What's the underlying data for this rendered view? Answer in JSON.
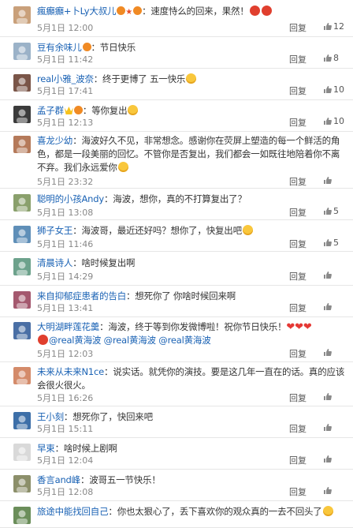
{
  "comments": [
    {
      "user": "瘋癲癲+卜Ly大叔儿",
      "text": "：速度恃么的回来，果然！",
      "time": "5月1日 12:00",
      "reply": "回复",
      "likes": "12",
      "avatar": "#c9a07a"
    },
    {
      "user": "豆有余味儿",
      "text": "：节日快乐",
      "time": "5月1日 11:42",
      "reply": "回复",
      "likes": "8",
      "avatar": "#9bb2c8"
    },
    {
      "user": "real小雅_波奈",
      "text": "：终于更博了 五一快乐",
      "time": "5月1日 17:41",
      "reply": "回复",
      "likes": "10",
      "avatar": "#7a5548"
    },
    {
      "user": "孟子群",
      "text": "：等你复出",
      "time": "5月1日 12:13",
      "reply": "回复",
      "likes": "10",
      "avatar": "#3b3b3b"
    },
    {
      "user": "喜龙少幼",
      "text": "：海波好久不见，非常想念。感谢你在荧屏上塑造的每一个鲜活的角色，都是一段美丽的回忆。不管你是否复出，我们都会一如既往地陪着你不离不弃。我们永远爱你",
      "time": "5月1日 23:32",
      "reply": "回复",
      "likes": "",
      "avatar": "#b57a5a"
    },
    {
      "user": "聪明的小孩Andy",
      "text": "：海波，想你，真的不打算复出了？",
      "time": "5月1日 13:08",
      "reply": "回复",
      "likes": "5",
      "avatar": "#8aa06c"
    },
    {
      "user": "狮子女王",
      "text": "：海波哥，最近还好吗？想你了，快复出吧",
      "time": "5月1日 11:46",
      "reply": "回复",
      "likes": "5",
      "avatar": "#5f8fb8"
    },
    {
      "user": "清晨诗人",
      "text": "：啥时候复出啊",
      "time": "5月1日 14:29",
      "reply": "回复",
      "likes": "",
      "avatar": "#6da28c"
    },
    {
      "user": "来自抑郁症患者的告白",
      "text": "：想死你了 你啥时候回来啊",
      "time": "5月1日 13:41",
      "reply": "回复",
      "likes": "",
      "avatar": "#a4586e"
    },
    {
      "user": "大明湖畔莲花羹",
      "text": "：海波，终于等到你发微博啦！祝你节日快乐！",
      "mentions": "@real黄海波 @real黄海波 @real黄海波",
      "time": "5月1日 12:03",
      "reply": "回复",
      "likes": "",
      "avatar": "#4a6fa5"
    },
    {
      "user": "未来从未来N1ce",
      "text": "：说实话。就凭你的演技。要是这几年一直在的话。真的应该会很火很火。",
      "time": "5月1日 16:26",
      "reply": "回复",
      "likes": "",
      "avatar": "#d48b6a"
    },
    {
      "user": "王小刻",
      "text": "：想死你了，快回来吧",
      "time": "5月1日 15:11",
      "reply": "回复",
      "likes": "",
      "avatar": "#3d6fa8"
    },
    {
      "user": "早束",
      "text": "：啥时候上剧啊",
      "time": "5月1日 12:04",
      "reply": "回复",
      "likes": "",
      "avatar": "#d9d9d9"
    },
    {
      "user": "香言and峰",
      "text": "：波哥五一节快乐！",
      "time": "5月1日 12:08",
      "reply": "回复",
      "likes": "",
      "avatar": "#8c8f6a"
    },
    {
      "user": "旅途中能找回自己",
      "text": "：你也太狠心了，丢下喜欢你的观众真的一去不回头了",
      "time": "",
      "reply": "",
      "likes": "",
      "avatar": "#6b8e5a"
    }
  ]
}
